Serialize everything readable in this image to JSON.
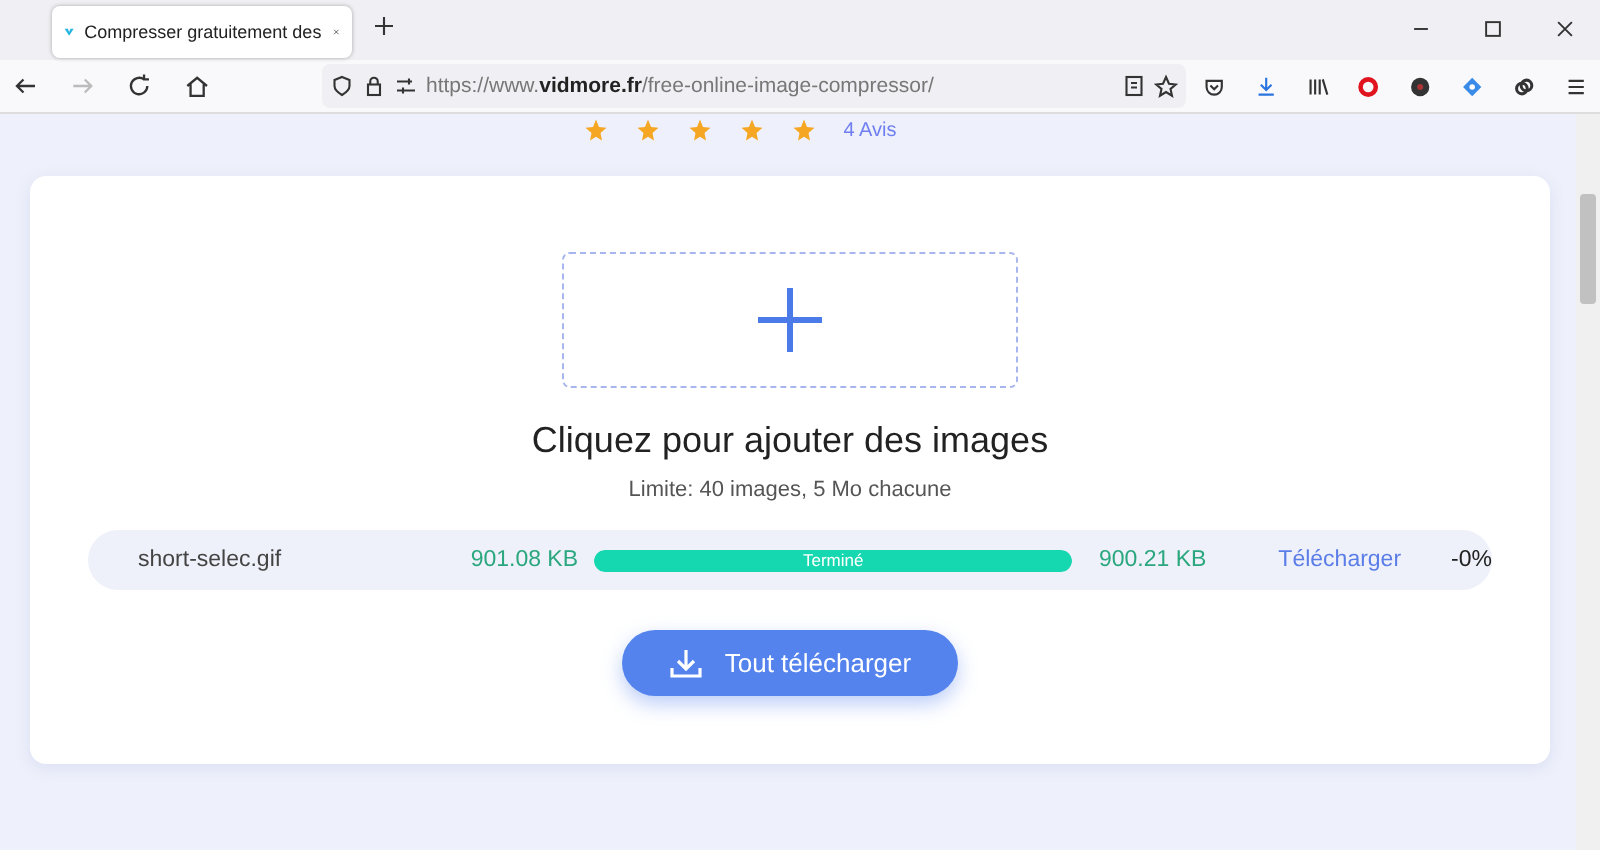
{
  "browser": {
    "tab": {
      "title": "Compresser gratuitement des",
      "selected": true
    },
    "url": "https://www.**vidmore.fr**/free-online-image-compressor/"
  },
  "rating": {
    "stars": 5,
    "text": "4 Avis"
  },
  "upload": {
    "title": "Cliquez pour ajouter des images",
    "limit": "Limite: 40 images, 5 Mo chacune"
  },
  "files": [
    {
      "name": "short-selec.gif",
      "original_size": "901.08 KB",
      "status": "Terminé",
      "level": 1,
      "new_size": "900.21 KB",
      "download": "Télécharger",
      "ratio": "-0%"
    }
  ],
  "download_all": "Tout télécharger"
}
